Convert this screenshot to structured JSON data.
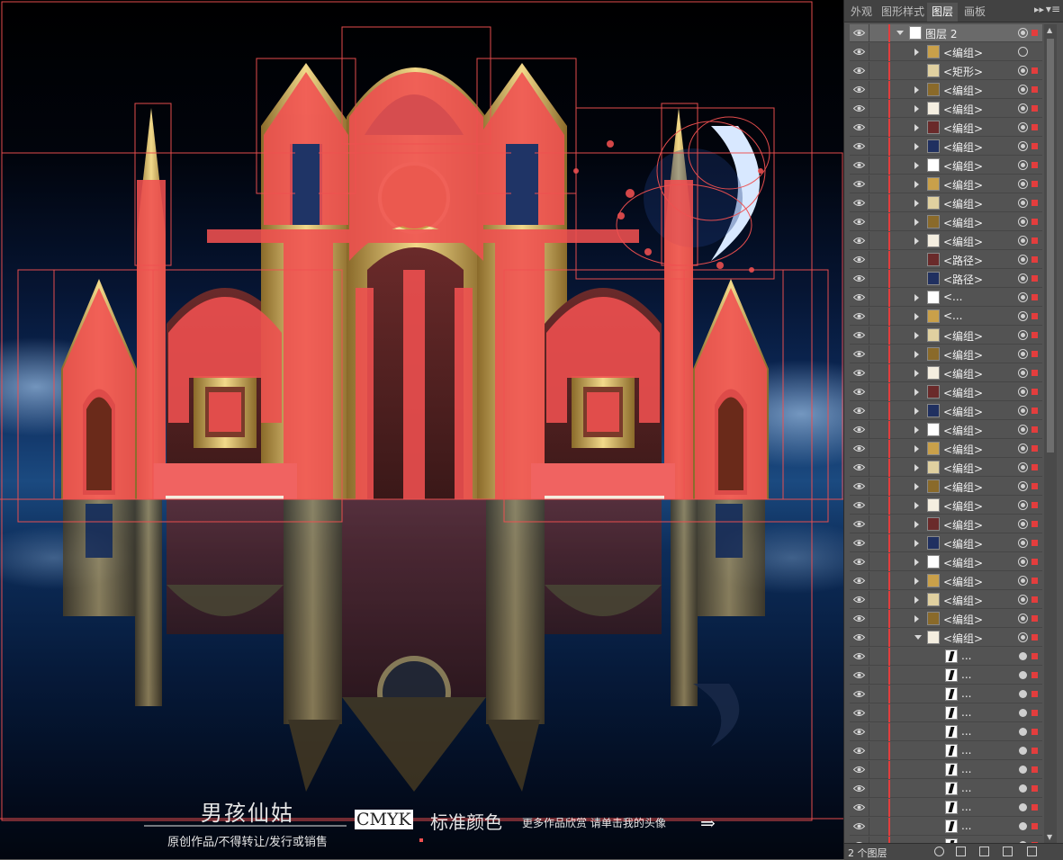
{
  "canvas": {
    "title_text": "男孩仙姑",
    "subtitle_text": "原创作品/不得转让/发行或销售",
    "cmyk_label": "CMYK",
    "standard_color_text": "标准颜色",
    "more_works_text": "更多作品欣赏 请单击我的头像",
    "arrow_glyph": "⇒"
  },
  "panel": {
    "tabs": [
      {
        "label": "外观",
        "active": false
      },
      {
        "label": "图形样式",
        "active": false
      },
      {
        "label": "图层",
        "active": true
      },
      {
        "label": "画板",
        "active": false
      }
    ],
    "collapse_glyph": "▸▸",
    "menu_glyph": "▾≡",
    "footer": {
      "layer_count": "2 个图层"
    },
    "rows": [
      {
        "name": "图层 2",
        "level": 0,
        "toggle": "open",
        "target": "sel",
        "top": true
      },
      {
        "name": "<编组>",
        "level": 1,
        "toggle": "closed",
        "target": "ring",
        "nosel": true
      },
      {
        "name": "<矩形>",
        "level": 1,
        "toggle": "",
        "target": "sel"
      },
      {
        "name": "<编组>",
        "level": 1,
        "toggle": "closed",
        "target": "sel"
      },
      {
        "name": "<编组>",
        "level": 1,
        "toggle": "closed",
        "target": "sel"
      },
      {
        "name": "<编组>",
        "level": 1,
        "toggle": "closed",
        "target": "sel"
      },
      {
        "name": "<编组>",
        "level": 1,
        "toggle": "closed",
        "target": "sel"
      },
      {
        "name": "<编组>",
        "level": 1,
        "toggle": "closed",
        "target": "sel"
      },
      {
        "name": "<编组>",
        "level": 1,
        "toggle": "closed",
        "target": "sel"
      },
      {
        "name": "<编组>",
        "level": 1,
        "toggle": "closed",
        "target": "sel"
      },
      {
        "name": "<编组>",
        "level": 1,
        "toggle": "closed",
        "target": "sel"
      },
      {
        "name": "<编组>",
        "level": 1,
        "toggle": "closed",
        "target": "sel"
      },
      {
        "name": "<路径>",
        "level": 1,
        "toggle": "",
        "target": "sel"
      },
      {
        "name": "<路径>",
        "level": 1,
        "toggle": "",
        "target": "sel"
      },
      {
        "name": "<...",
        "level": 1,
        "toggle": "closed",
        "target": "sel"
      },
      {
        "name": "<...",
        "level": 1,
        "toggle": "closed",
        "target": "sel"
      },
      {
        "name": "<编组>",
        "level": 1,
        "toggle": "closed",
        "target": "sel"
      },
      {
        "name": "<编组>",
        "level": 1,
        "toggle": "closed",
        "target": "sel"
      },
      {
        "name": "<编组>",
        "level": 1,
        "toggle": "closed",
        "target": "sel"
      },
      {
        "name": "<编组>",
        "level": 1,
        "toggle": "closed",
        "target": "sel"
      },
      {
        "name": "<编组>",
        "level": 1,
        "toggle": "closed",
        "target": "sel"
      },
      {
        "name": "<编组>",
        "level": 1,
        "toggle": "closed",
        "target": "sel"
      },
      {
        "name": "<编组>",
        "level": 1,
        "toggle": "closed",
        "target": "sel"
      },
      {
        "name": "<编组>",
        "level": 1,
        "toggle": "closed",
        "target": "sel"
      },
      {
        "name": "<编组>",
        "level": 1,
        "toggle": "closed",
        "target": "sel"
      },
      {
        "name": "<编组>",
        "level": 1,
        "toggle": "closed",
        "target": "sel"
      },
      {
        "name": "<编组>",
        "level": 1,
        "toggle": "closed",
        "target": "sel"
      },
      {
        "name": "<编组>",
        "level": 1,
        "toggle": "closed",
        "target": "sel"
      },
      {
        "name": "<编组>",
        "level": 1,
        "toggle": "closed",
        "target": "sel"
      },
      {
        "name": "<编组>",
        "level": 1,
        "toggle": "closed",
        "target": "sel"
      },
      {
        "name": "<编组>",
        "level": 1,
        "toggle": "closed",
        "target": "sel"
      },
      {
        "name": "<编组>",
        "level": 1,
        "toggle": "closed",
        "target": "sel"
      },
      {
        "name": "<编组>",
        "level": 1,
        "toggle": "open",
        "target": "sel"
      },
      {
        "name": "...",
        "level": 2,
        "toggle": "",
        "target": "dot"
      },
      {
        "name": "...",
        "level": 2,
        "toggle": "",
        "target": "dot"
      },
      {
        "name": "...",
        "level": 2,
        "toggle": "",
        "target": "dot"
      },
      {
        "name": "...",
        "level": 2,
        "toggle": "",
        "target": "dot"
      },
      {
        "name": "...",
        "level": 2,
        "toggle": "",
        "target": "dot"
      },
      {
        "name": "...",
        "level": 2,
        "toggle": "",
        "target": "dot"
      },
      {
        "name": "...",
        "level": 2,
        "toggle": "",
        "target": "dot"
      },
      {
        "name": "...",
        "level": 2,
        "toggle": "",
        "target": "dot"
      },
      {
        "name": "...",
        "level": 2,
        "toggle": "",
        "target": "dot"
      },
      {
        "name": "...",
        "level": 2,
        "toggle": "",
        "target": "dot"
      },
      {
        "name": "...",
        "level": 2,
        "toggle": "",
        "target": "dot"
      }
    ]
  }
}
